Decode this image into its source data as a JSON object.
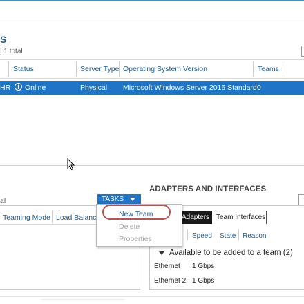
{
  "servers": {
    "title": "S",
    "count": "| 1 total",
    "columns": [
      "Status",
      "Server Type",
      "Operating System Version",
      "Teams"
    ],
    "selected_row": {
      "name_fragment": "HR",
      "status": "Online",
      "server_type": "Physical",
      "os_version": "Microsoft Windows Server 2016 Standard",
      "teams": "0"
    }
  },
  "teams": {
    "left_label": "al",
    "tasks_label": "TASKS",
    "columns": [
      "Teaming Mode",
      "Load Balancin"
    ]
  },
  "tasks_menu": {
    "items": [
      {
        "label": "New Team",
        "enabled": true
      },
      {
        "label": "Delete",
        "enabled": false
      },
      {
        "label": "Properties",
        "enabled": false
      }
    ]
  },
  "adapters": {
    "title": "ADAPTERS AND INTERFACES",
    "tabs": [
      "Adapters",
      "Team Interfaces"
    ],
    "columns": [
      "Speed",
      "State",
      "Reason"
    ],
    "group_label": "Available to be added to a team (2)",
    "rows": [
      {
        "name": "Ethernet",
        "speed": "1 Gbps"
      },
      {
        "name": "Ethernet 2",
        "speed": "1 Gbps"
      }
    ]
  },
  "colors": {
    "accent": "#1e74c6",
    "header_text": "#1f5d95",
    "highlight_circle": "#c0504d"
  },
  "icons": [
    "online-status-icon",
    "mouse-cursor-icon",
    "tasks-dropdown-icon",
    "collapse-triangle-icon"
  ]
}
